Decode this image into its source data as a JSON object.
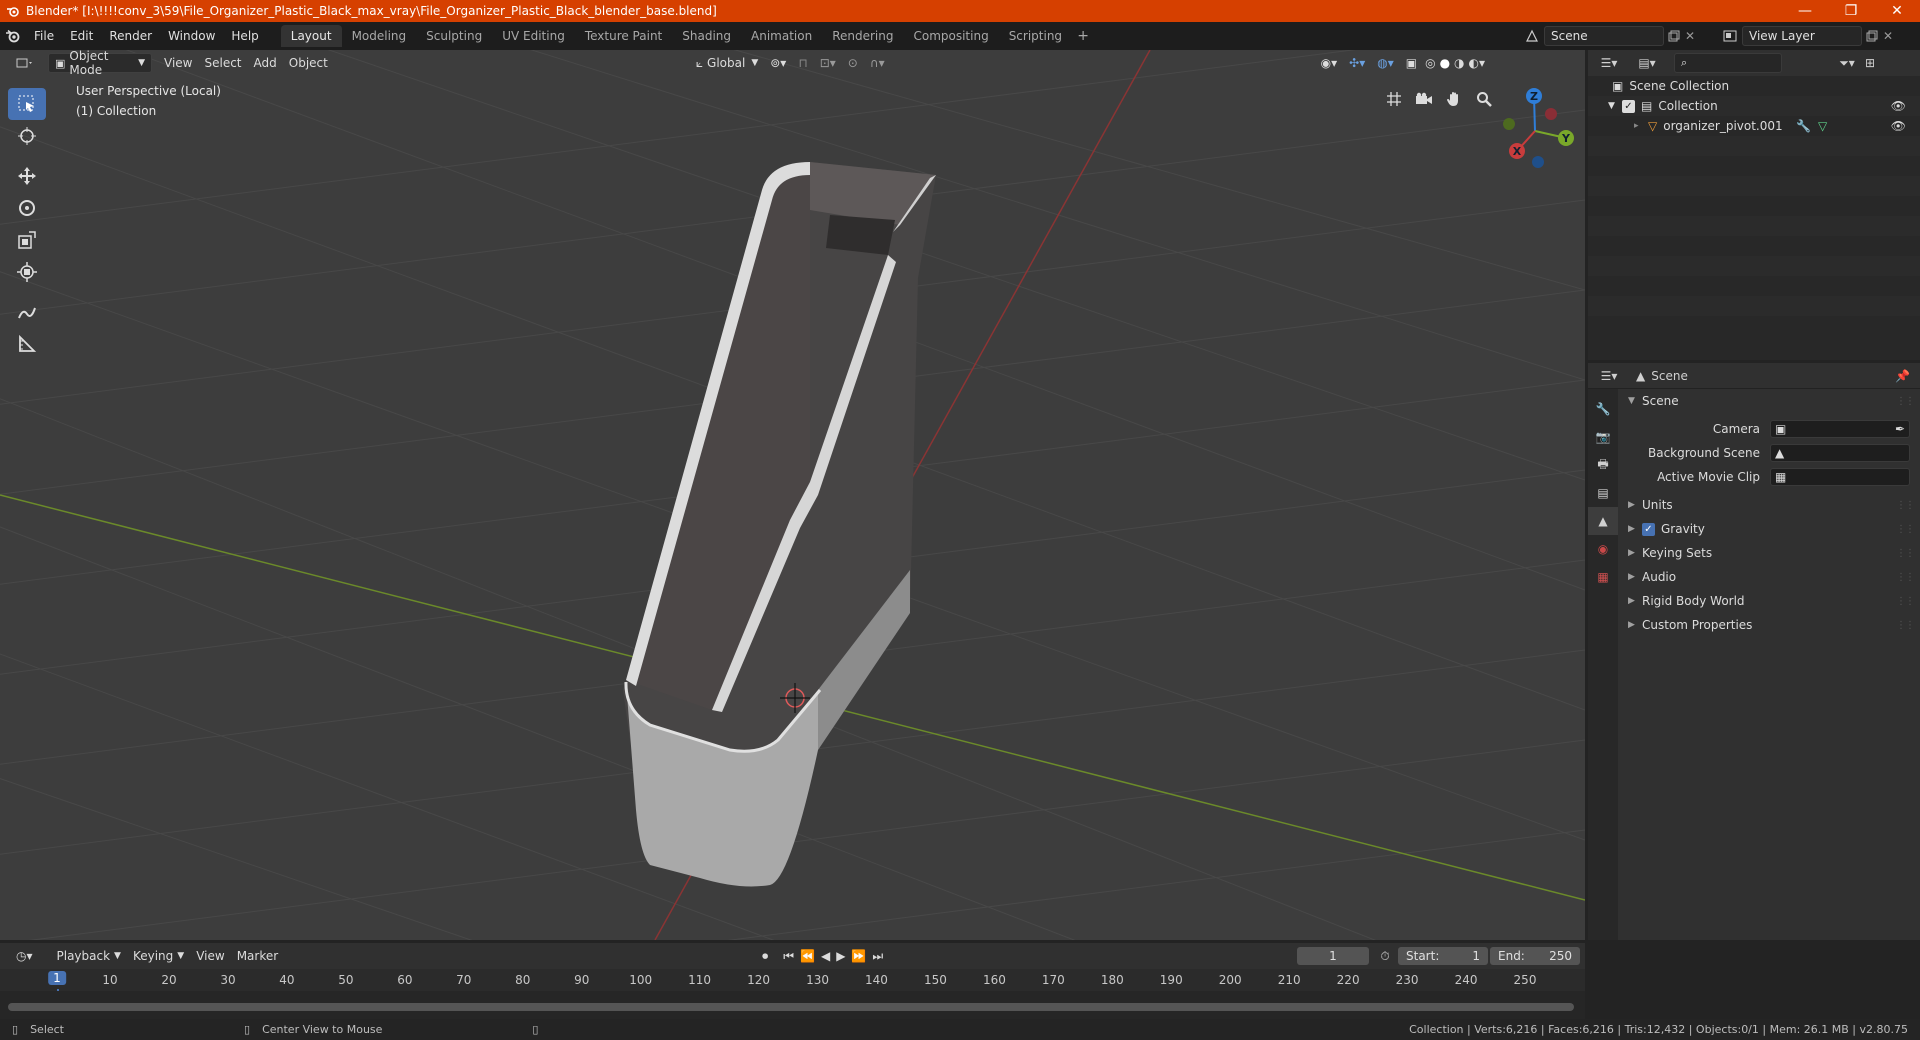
{
  "titlebar": {
    "title": "Blender* [I:\\!!!!conv_3\\59\\File_Organizer_Plastic_Black_max_vray\\File_Organizer_Plastic_Black_blender_base.blend]",
    "minimize": "—",
    "maximize": "❐",
    "close": "✕"
  },
  "menu": [
    "File",
    "Edit",
    "Render",
    "Window",
    "Help"
  ],
  "workspaces": [
    "Layout",
    "Modeling",
    "Sculpting",
    "UV Editing",
    "Texture Paint",
    "Shading",
    "Animation",
    "Rendering",
    "Compositing",
    "Scripting"
  ],
  "active_workspace": "Layout",
  "scene_selector": {
    "value": "Scene"
  },
  "view_layer_selector": {
    "value": "View Layer"
  },
  "viewport": {
    "mode": "Object Mode",
    "menus": [
      "View",
      "Select",
      "Add",
      "Object"
    ],
    "transform_orientation": "Global",
    "perspective_label": "User Perspective (Local)",
    "collection_label": "(1) Collection",
    "gizmo": {
      "z": "Z",
      "y": "Y",
      "x": "X"
    }
  },
  "outliner": {
    "root": "Scene Collection",
    "collection": "Collection",
    "object": "organizer_pivot.001"
  },
  "properties": {
    "context": "Scene",
    "section": "Scene",
    "fields": [
      {
        "label": "Camera"
      },
      {
        "label": "Background Scene"
      },
      {
        "label": "Active Movie Clip"
      }
    ],
    "panels": [
      "Units",
      "Gravity",
      "Keying Sets",
      "Audio",
      "Rigid Body World",
      "Custom Properties"
    ]
  },
  "timeline": {
    "menus": [
      "Playback",
      "Keying",
      "View",
      "Marker"
    ],
    "current_frame": "1",
    "start_label": "Start:",
    "start": "1",
    "end_label": "End:",
    "end": "250",
    "ticks": [
      "1",
      "10",
      "20",
      "30",
      "40",
      "50",
      "60",
      "70",
      "80",
      "90",
      "100",
      "110",
      "120",
      "130",
      "140",
      "150",
      "160",
      "170",
      "180",
      "190",
      "200",
      "210",
      "220",
      "230",
      "240",
      "250"
    ]
  },
  "statusbar": {
    "left": "Select",
    "middle": "Center View to Mouse",
    "right": "Collection | Verts:6,216 | Faces:6,216 | Tris:12,432 | Objects:0/1 | Mem: 26.1 MB | v2.80.75"
  },
  "colors": {
    "titlebar": "#d64000",
    "accent": "#4772b3",
    "viewport_bg": "#3d3d3d",
    "x_axis": "#c83c3c",
    "y_axis": "#7aa82a",
    "z_axis": "#2f7ed8"
  }
}
